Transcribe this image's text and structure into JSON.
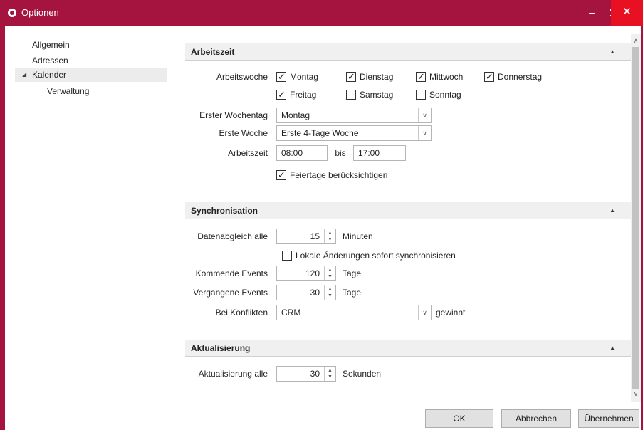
{
  "window": {
    "title": "Optionen"
  },
  "window_controls": {
    "minimize": "–",
    "maximize": "",
    "close": "✕"
  },
  "nav": {
    "items": [
      {
        "label": "Allgemein"
      },
      {
        "label": "Adressen"
      },
      {
        "label": "Kalender",
        "expanded": true,
        "selected": true
      },
      {
        "label": "Verwaltung"
      }
    ]
  },
  "sections": {
    "arbeitszeit": {
      "title": "Arbeitszeit",
      "arbeitswoche_label": "Arbeitswoche",
      "days": [
        {
          "label": "Montag",
          "checked": true
        },
        {
          "label": "Dienstag",
          "checked": true
        },
        {
          "label": "Mittwoch",
          "checked": true
        },
        {
          "label": "Donnerstag",
          "checked": true
        },
        {
          "label": "Freitag",
          "checked": true
        },
        {
          "label": "Samstag",
          "checked": false
        },
        {
          "label": "Sonntag",
          "checked": false
        }
      ],
      "erster_wochentag_label": "Erster Wochentag",
      "erster_wochentag_value": "Montag",
      "erste_woche_label": "Erste Woche",
      "erste_woche_value": "Erste 4-Tage Woche",
      "arbeitszeit_label": "Arbeitszeit",
      "von": "08:00",
      "bis_label": "bis",
      "bis": "17:00",
      "feiertage_label": "Feiertage berücksichtigen",
      "feiertage_checked": true
    },
    "synchronisation": {
      "title": "Synchronisation",
      "datenabgleich_label": "Datenabgleich alle",
      "datenabgleich_value": "15",
      "datenabgleich_unit": "Minuten",
      "lokale_label": "Lokale Änderungen sofort synchronisieren",
      "lokale_checked": false,
      "kommende_label": "Kommende Events",
      "kommende_value": "120",
      "kommende_unit": "Tage",
      "vergangene_label": "Vergangene Events",
      "vergangene_value": "30",
      "vergangene_unit": "Tage",
      "konflikte_label": "Bei Konflikten",
      "konflikte_value": "CRM",
      "konflikte_suffix": "gewinnt"
    },
    "aktualisierung": {
      "title": "Aktualisierung",
      "aktualisierung_label": "Aktualisierung alle",
      "aktualisierung_value": "30",
      "aktualisierung_unit": "Sekunden"
    }
  },
  "buttons": {
    "ok": "OK",
    "cancel": "Abbrechen",
    "apply": "Übernehmen"
  },
  "colors": {
    "titlebar": "#a5143f",
    "close": "#e81123"
  }
}
